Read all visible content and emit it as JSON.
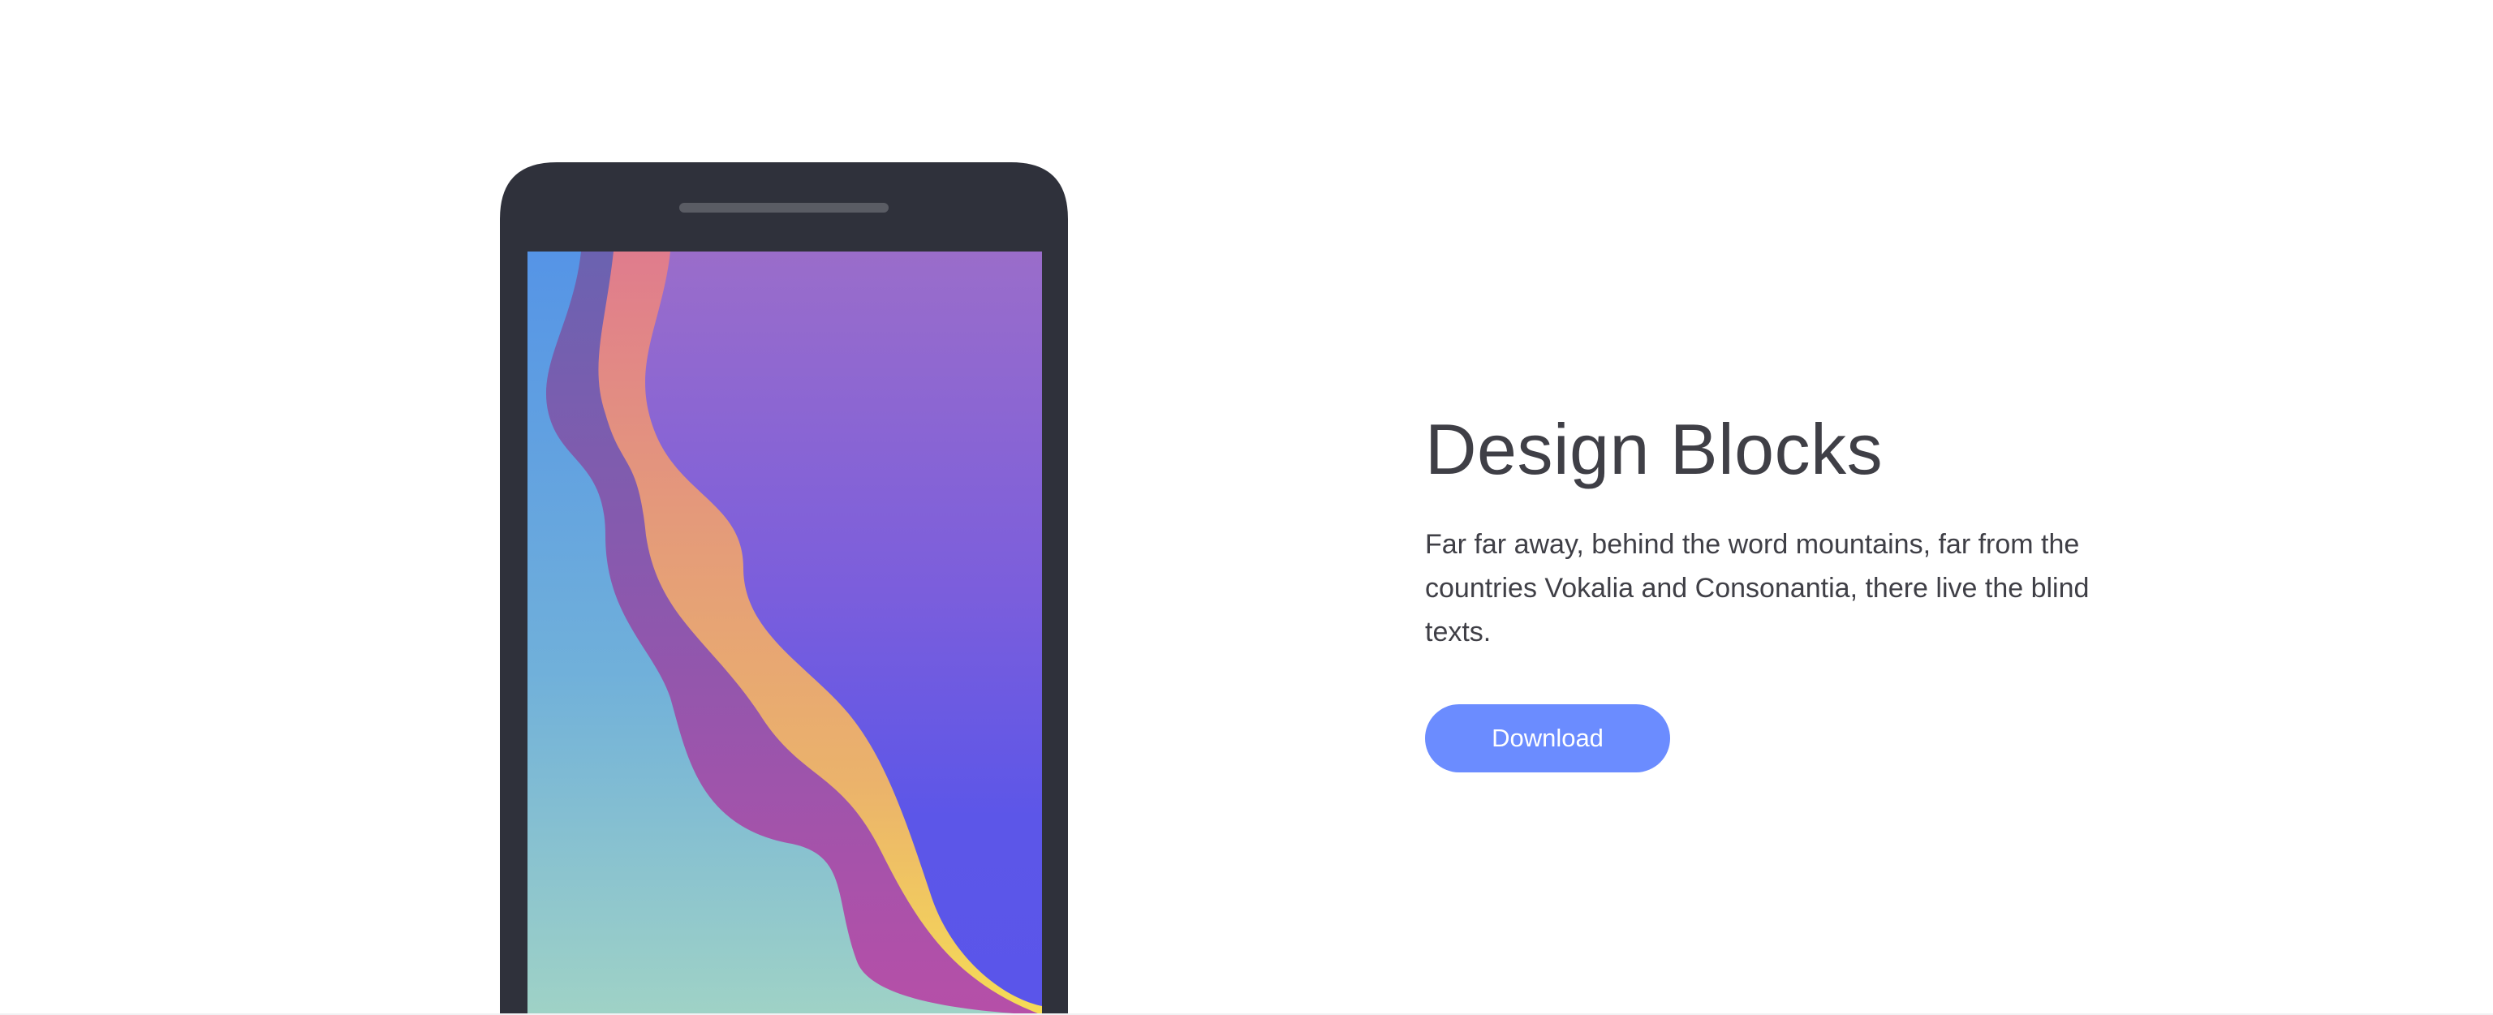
{
  "hero": {
    "title": "Design Blocks",
    "description": "Far far away, behind the word mountains, far from the countries Vokalia and Consonantia, there live the blind texts.",
    "download_label": "Download"
  },
  "colors": {
    "background": "#ffffff",
    "text": "#3f3f46",
    "button": "#6b8cff",
    "phone_body": "#2f313b",
    "speaker": "#5a5c64"
  },
  "icons": {
    "phone_illustration": "smartphone-icon"
  }
}
